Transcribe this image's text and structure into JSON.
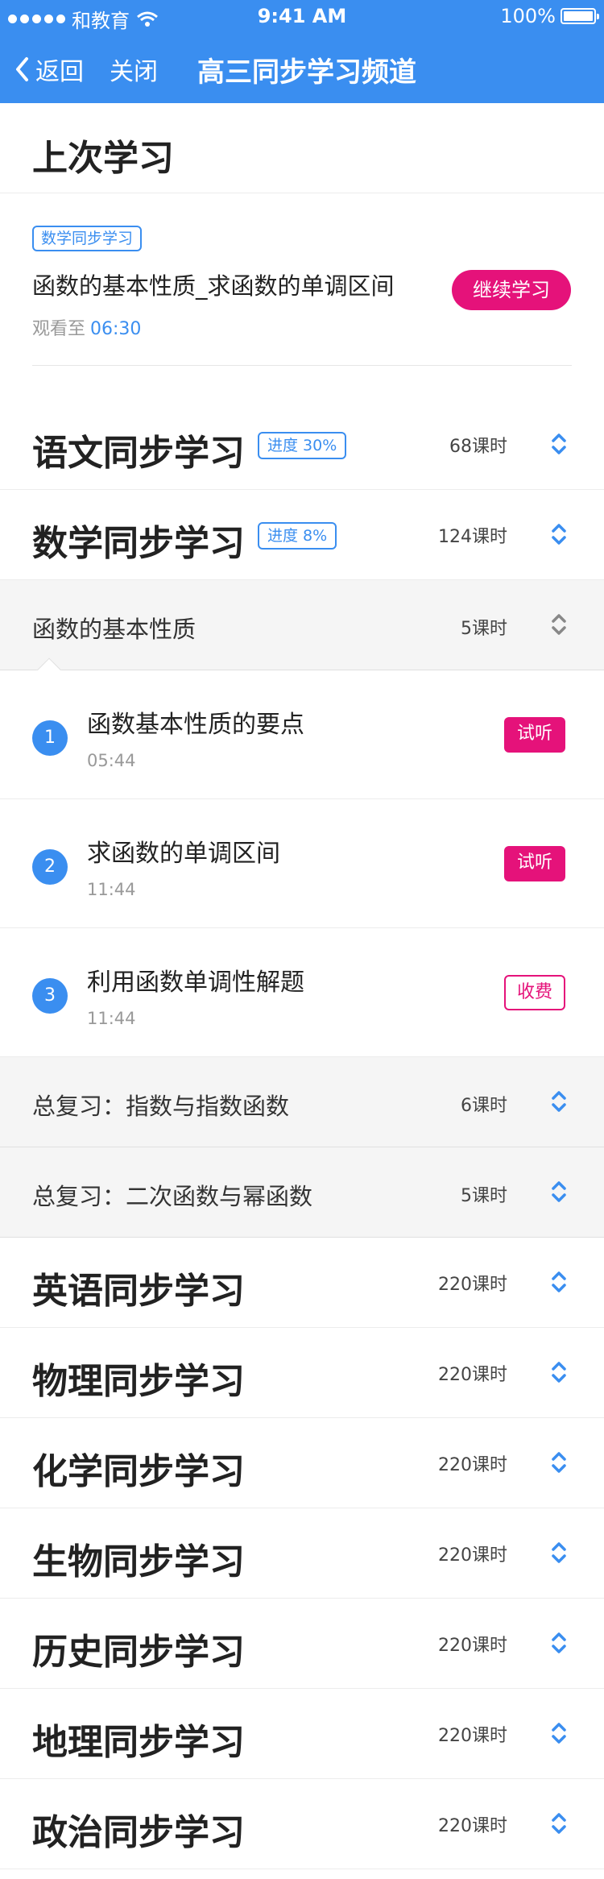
{
  "status_bar": {
    "carrier": "和教育",
    "time": "9:41 AM",
    "battery": "100%"
  },
  "nav": {
    "back_label": "返回",
    "close_label": "关闭",
    "title": "高三同步学习频道"
  },
  "last_study": {
    "heading": "上次学习",
    "tag": "数学同步学习",
    "lesson_title": "函数的基本性质_求函数的单调区间",
    "watched_prefix": "观看至",
    "watched_time": "06:30",
    "continue_label": "继续学习"
  },
  "subjects": [
    {
      "name": "语文同步学习",
      "progress": "进度 30%",
      "hours": "68课时"
    },
    {
      "name": "数学同步学习",
      "progress": "进度 8%",
      "hours": "124课时"
    },
    {
      "name": "英语同步学习",
      "hours": "220课时"
    },
    {
      "name": "物理同步学习",
      "hours": "220课时"
    },
    {
      "name": "化学同步学习",
      "hours": "220课时"
    },
    {
      "name": "生物同步学习",
      "hours": "220课时"
    },
    {
      "name": "历史同步学习",
      "hours": "220课时"
    },
    {
      "name": "地理同步学习",
      "hours": "220课时"
    },
    {
      "name": "政治同步学习",
      "hours": "220课时"
    }
  ],
  "math_chapters": [
    {
      "name": "函数的基本性质",
      "hours": "5课时"
    },
    {
      "name": "总复习：指数与指数函数",
      "hours": "6课时"
    },
    {
      "name": "总复习：二次函数与幂函数",
      "hours": "5课时"
    }
  ],
  "lessons": [
    {
      "num": "1",
      "title": "函数基本性质的要点",
      "duration": "05:44",
      "badge": "试听"
    },
    {
      "num": "2",
      "title": "求函数的单调区间",
      "duration": "11:44",
      "badge": "试听"
    },
    {
      "num": "3",
      "title": "利用函数单调性解题",
      "duration": "11:44",
      "badge": "收费"
    }
  ],
  "colors": {
    "primary": "#3a8ef0",
    "accent": "#e5127a"
  },
  "icons": {
    "toggle": "up-down-chevron-icon",
    "back": "chevron-left-icon"
  }
}
